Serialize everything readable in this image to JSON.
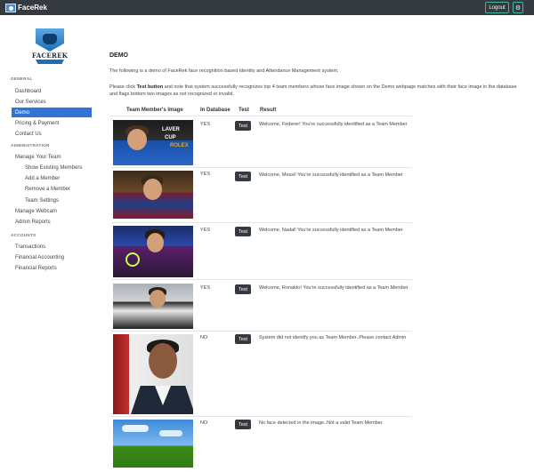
{
  "navbar": {
    "brand": "FaceRek",
    "logout_label": "Logout",
    "settings_icon": "gear-icon"
  },
  "sidebar": {
    "logo_text": "FACEREK",
    "sections": [
      {
        "title": "GENERAL",
        "items": [
          {
            "label": "Dashboard",
            "active": false
          },
          {
            "label": "Our Services",
            "active": false
          },
          {
            "label": "Demo",
            "active": true
          },
          {
            "label": "Pricing & Payment",
            "active": false
          },
          {
            "label": "Contact Us",
            "active": false
          }
        ]
      },
      {
        "title": "ADMINISTRATION",
        "items": [
          {
            "label": "Manage Your Team"
          },
          {
            "label": "Show Existing Members"
          },
          {
            "label": "Add a Member"
          },
          {
            "label": "Remove a Member"
          },
          {
            "label": "Team Settings"
          },
          {
            "label": "Manage Webcam"
          },
          {
            "label": "Admin Reports"
          }
        ]
      },
      {
        "title": "ACCOUNTS",
        "items": [
          {
            "label": "Transactions"
          },
          {
            "label": "Financial Accounting"
          },
          {
            "label": "Financial Reports"
          }
        ]
      }
    ],
    "active_color": "#2f75d6"
  },
  "main": {
    "title": "DEMO",
    "intro": "The following is a demo of FaceRek face recognition based Identity and Attendance Management system.",
    "instructions_prefix": "Please click ",
    "instructions_bold": "Test button",
    "instructions_line1_rest": " and note that system successfully recognizes top 4 team members whose face image shown on the Demo webpage matches with their face image in the database",
    "instructions_line2": "and flags bottom two images as not recognized or invalid.",
    "table": {
      "headers": [
        "Team Member's Image",
        "In Database",
        "Test",
        "Result"
      ],
      "rows": [
        {
          "in_db": "YES",
          "test": "Test",
          "result": "Welcome, Federer! You're successfully identified as a Team Member"
        },
        {
          "in_db": "YES",
          "test": "Test",
          "result": "Welcome, Messi! You're successfully identified as a Team Member"
        },
        {
          "in_db": "YES",
          "test": "Test",
          "result": "Welcome, Nadal! You're successfully identified as a Team Member"
        },
        {
          "in_db": "YES",
          "test": "Test",
          "result": "Welcome, Ronaldo! You're successfully identified as a Team Member"
        },
        {
          "in_db": "NO",
          "test": "Test",
          "result": "System did not identify you as Team Member..Please contact Admin"
        },
        {
          "in_db": "NO",
          "test": "Test",
          "result": "No face detected in the image..Not a valid Team Member"
        }
      ]
    },
    "photo_badge_1": "LAVER",
    "photo_badge_2": "CUP",
    "photo_badge_3": "ROLEX"
  }
}
